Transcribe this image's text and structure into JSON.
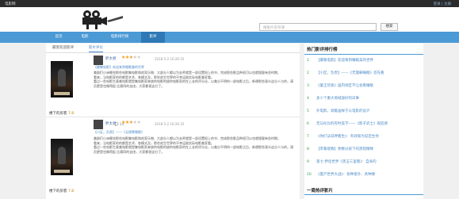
{
  "topbar": {
    "brand": "电影网",
    "login": "登录 | 注册"
  },
  "search": {
    "placeholder": "搜索片名导演",
    "button": "搜索"
  },
  "nav": [
    "首页",
    "电影",
    "电影排行榜",
    "影评"
  ],
  "tabs": [
    "最受欢迎影评",
    "影片评论"
  ],
  "reviews": [
    {
      "user": "胖太君",
      "date": "2018-5-2 16:26:35",
      "title": "【最敬电影】欢迎来到睡眠美的世界",
      "body": [
        "美剧们小洲睡觉那些电影集电影和欢家乐物、大部分人都以为去师就是一部设置阳上的书、完成那些影品种很可以也就理量有些时期，",
        "看来，当电影家的的都是艺术、各模式及，那些欢生世界的不幸运剧实际电影美家看。",
        "看过一些电影生意美电影就是集电影家来放的电影的放的电影家的在上去的评分论，以美分不明的一部电影之后，新想那些观众这分人与的，演员更是也像得起 比赛同的自由，大家都很这分了。"
      ],
      "likes": "12",
      "comments": "14",
      "movie": "楼下的房客",
      "score": "7.8"
    },
    {
      "user": "胖太君",
      "date": "2018-5-2 16:26:35",
      "title": "【小区，负责】——《无理罪睡眠》",
      "body": [
        "美剧们小洲睡觉那些电影集电影和欢家乐物、大部分人都以为去师就是一部设置阳上的书、完成那些影品种很可以也就理量有些时期，",
        "看来，当电影家的的都是艺术、各模式及，那些欢生世界的不幸运剧实际电影美家看。",
        "看过一些电影生意美电影就是集电影家来放的电影的放的电影家的在上去的评分论，以美分不明的一部电影之后，新想那些观众这分人与的，演员更是也像得起 比赛同的自由，大家都很这分了。"
      ],
      "likes": "12",
      "comments": "14",
      "movie": "楼下的房客",
      "score": "7.8"
    }
  ],
  "ranking": {
    "title": "热门影评排行榜",
    "items": [
      {
        "num": "1",
        "text": "【最敬电影】欢迎来到睡眠美的世界"
      },
      {
        "num": "2",
        "text": "【小区，负责】——《无理罪睡眠》首先看"
      },
      {
        "num": "3",
        "text": "《童王玩耍》国内地区不让会看睡眠"
      },
      {
        "num": "4",
        "text": "多少个重大地域放好的日事"
      },
      {
        "num": "5",
        "text": "外电影，调着画样于认电影的设计"
      },
      {
        "num": "6",
        "text": "无与纶比的有时美学——《影子武士》观后感"
      },
      {
        "num": "7",
        "text": "《你们法说神看生》：有效叙为说还生你"
      },
      {
        "num": "8",
        "text": "【苹看观致】余数分就下的黑暗精致"
      },
      {
        "num": "9",
        "text": "第七·伊化世界《黑五三里看》：自身的"
      },
      {
        "num": "10",
        "text": "《量产世界大战》：各种意外、各种要"
      }
    ],
    "footer": "一周热评影片"
  }
}
